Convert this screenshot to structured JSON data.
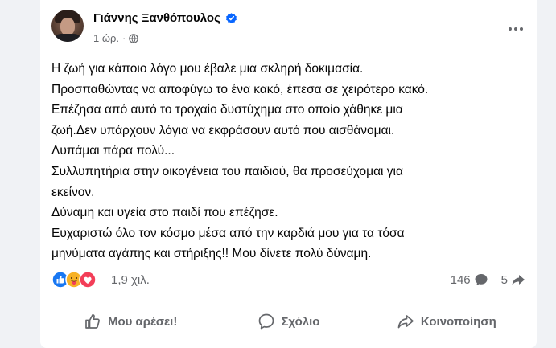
{
  "post": {
    "author": "Γιάννης Ξανθόπουλος",
    "time": "1 ώρ.",
    "dot": "·",
    "lines": [
      "Η ζωή για κάποιο λόγο μου έβαλε μια σκληρή δοκιμασία.",
      "Προσπαθώντας να αποφύγω το ένα κακό, έπεσα σε χειρότερο κακό.",
      "Επέζησα από αυτό το τροχαίο δυστύχημα στο οποίο χάθηκε μια",
      "ζωή.Δεν υπάρχουν λόγια να εκφράσουν αυτό που αισθάνομαι.",
      "Λυπάμαι πάρα πολύ...",
      "Συλλυπητήρια στην οικογένεια του παιδιού, θα προσεύχομαι για",
      "εκείνον.",
      "Δύναμη και υγεία στο παιδί που επέζησε.",
      "Ευχαριστώ όλο τον κόσμο μέσα από την καρδιά μου για τα τόσα",
      "μηνύματα αγάπης και στήριξης!! Μου δίνετε πολύ δύναμη."
    ],
    "reactions": {
      "count": "1,9 χιλ.",
      "types": [
        "like-icon",
        "care-icon",
        "love-icon"
      ],
      "colors": {
        "like": "#1877f2",
        "care": "#f7b125",
        "love": "#f33e58"
      }
    },
    "comments_count": "146",
    "shares_count": "5"
  },
  "actions": {
    "like": "Μου αρέσει!",
    "comment": "Σχόλιο",
    "share": "Κοινοποίηση"
  },
  "colors": {
    "background": "#f0f2f5",
    "card": "#ffffff",
    "text": "#050505",
    "secondary": "#65676b",
    "verified": "#0866ff"
  }
}
